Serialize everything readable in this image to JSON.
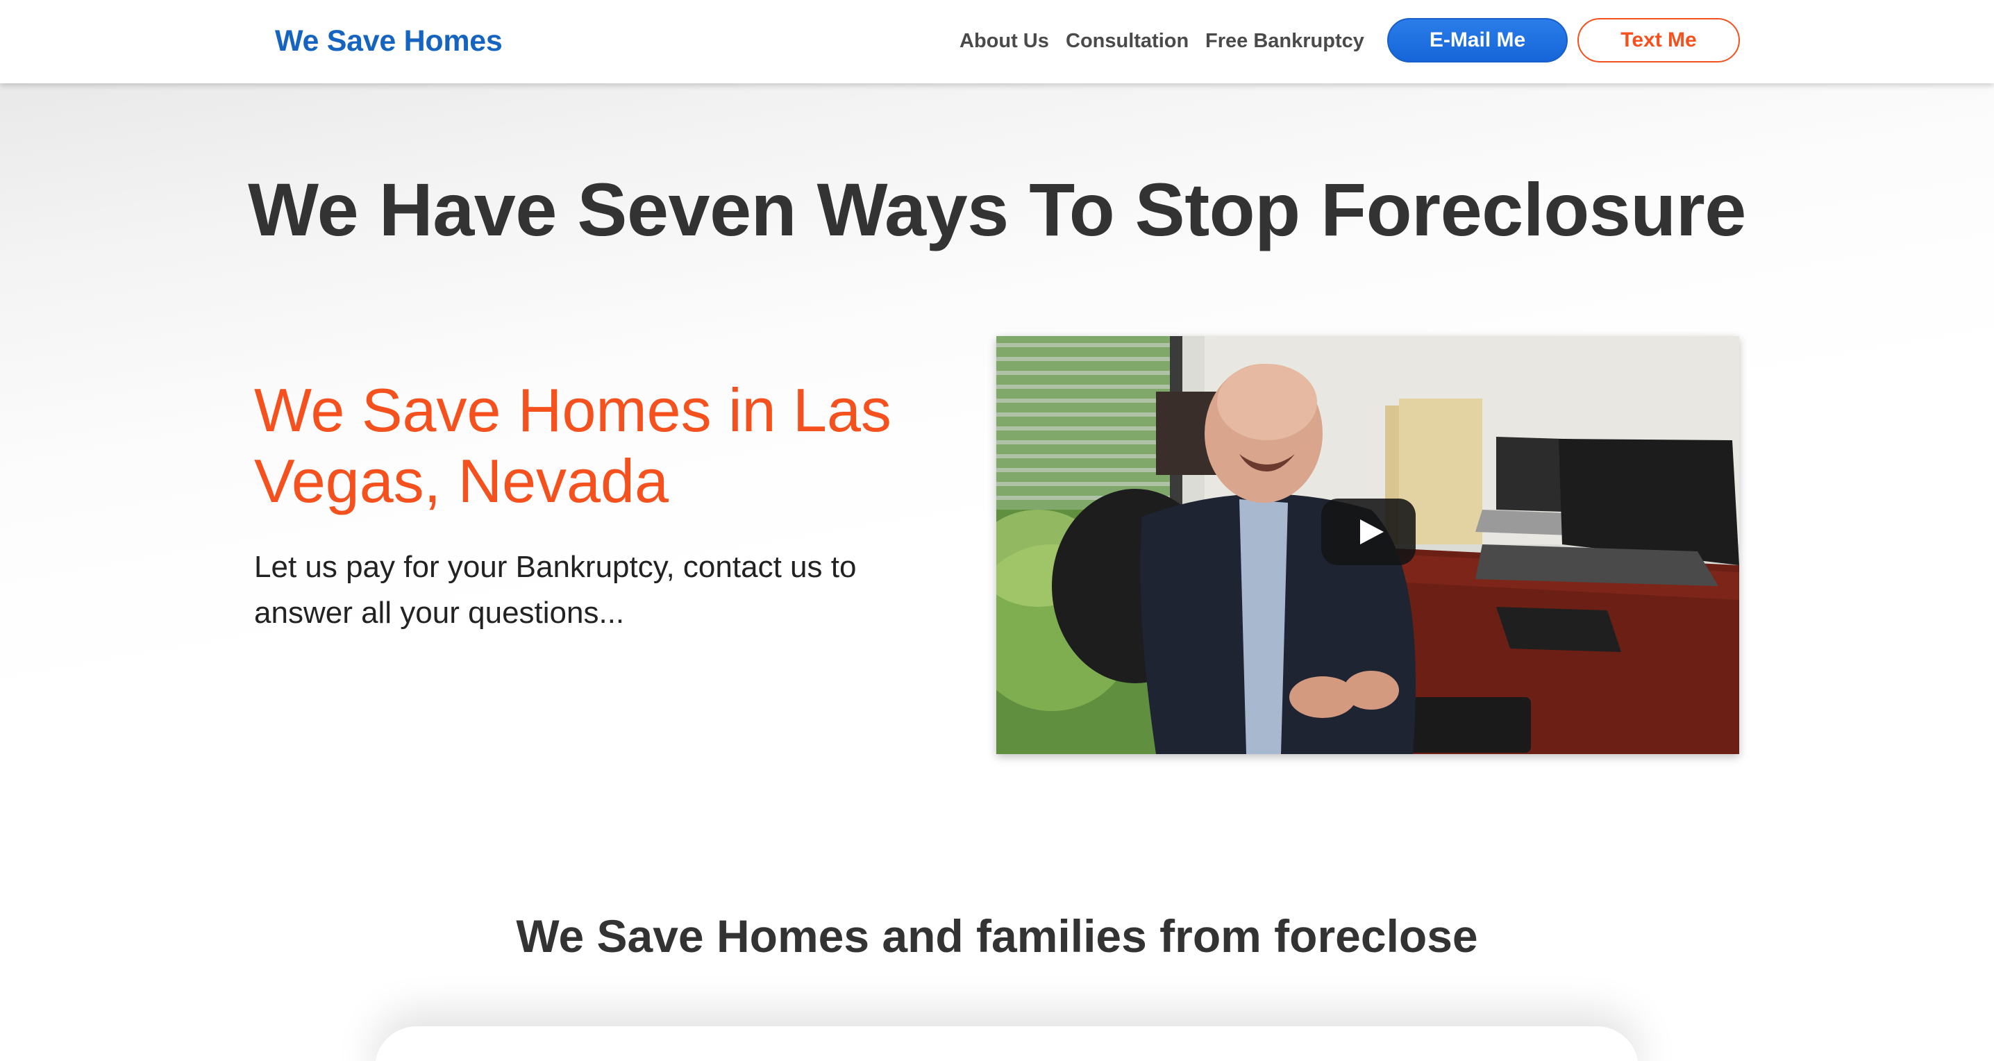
{
  "header": {
    "logo": "We Save Homes",
    "nav": [
      {
        "label": "About Us"
      },
      {
        "label": "Consultation"
      },
      {
        "label": "Free Bankruptcy"
      }
    ],
    "email_button": "E-Mail Me",
    "text_button": "Text Me"
  },
  "hero": {
    "title": "We Have Seven Ways To Stop Foreclosure",
    "subtitle": "We Save Homes in Las Vegas, Nevada",
    "description": "Let us pay for your Bankruptcy, contact us to answer all your questions...",
    "video": {
      "play_icon": "play-icon"
    }
  },
  "section2": {
    "title": "We Save Homes and families from foreclose"
  },
  "colors": {
    "brand_blue": "#1565c0",
    "accent_orange": "#f4511e",
    "heading": "#333333"
  }
}
